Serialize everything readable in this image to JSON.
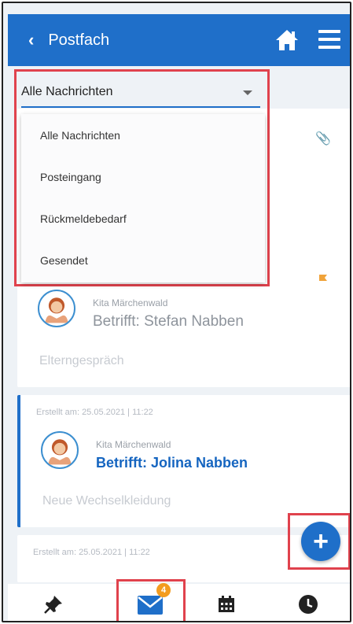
{
  "header": {
    "title": "Postfach",
    "back_icon": "chevron-left-icon",
    "home_icon": "home-icon",
    "menu_icon": "hamburger-menu-icon"
  },
  "filter": {
    "selected": "Alle Nachrichten",
    "options": [
      "Alle Nachrichten",
      "Posteingang",
      "Rückmeldebedarf",
      "Gesendet"
    ]
  },
  "messages": [
    {
      "sender": "Kita Märchenwald",
      "subject": "Betrifft: Stefan Nabben",
      "preview": "Elterngespräch",
      "flag_color": "#f0a33a",
      "unread": false
    },
    {
      "created": "Erstellt am: 25.05.2021 | 11:22",
      "sender": "Kita Märchenwald",
      "subject": "Betrifft: Jolina Nabben",
      "preview": "Neue Wechselkleidung",
      "unread": true
    },
    {
      "created": "Erstellt am: 25.05.2021 | 11:22"
    }
  ],
  "fab": {
    "label": "+"
  },
  "bottom_nav": {
    "items": [
      "pin-icon",
      "mail-icon",
      "calendar-icon",
      "clock-icon"
    ],
    "mail_badge": "4"
  },
  "colors": {
    "primary": "#1f6fc9",
    "highlight": "#e0424d",
    "badge": "#f39c1f"
  }
}
